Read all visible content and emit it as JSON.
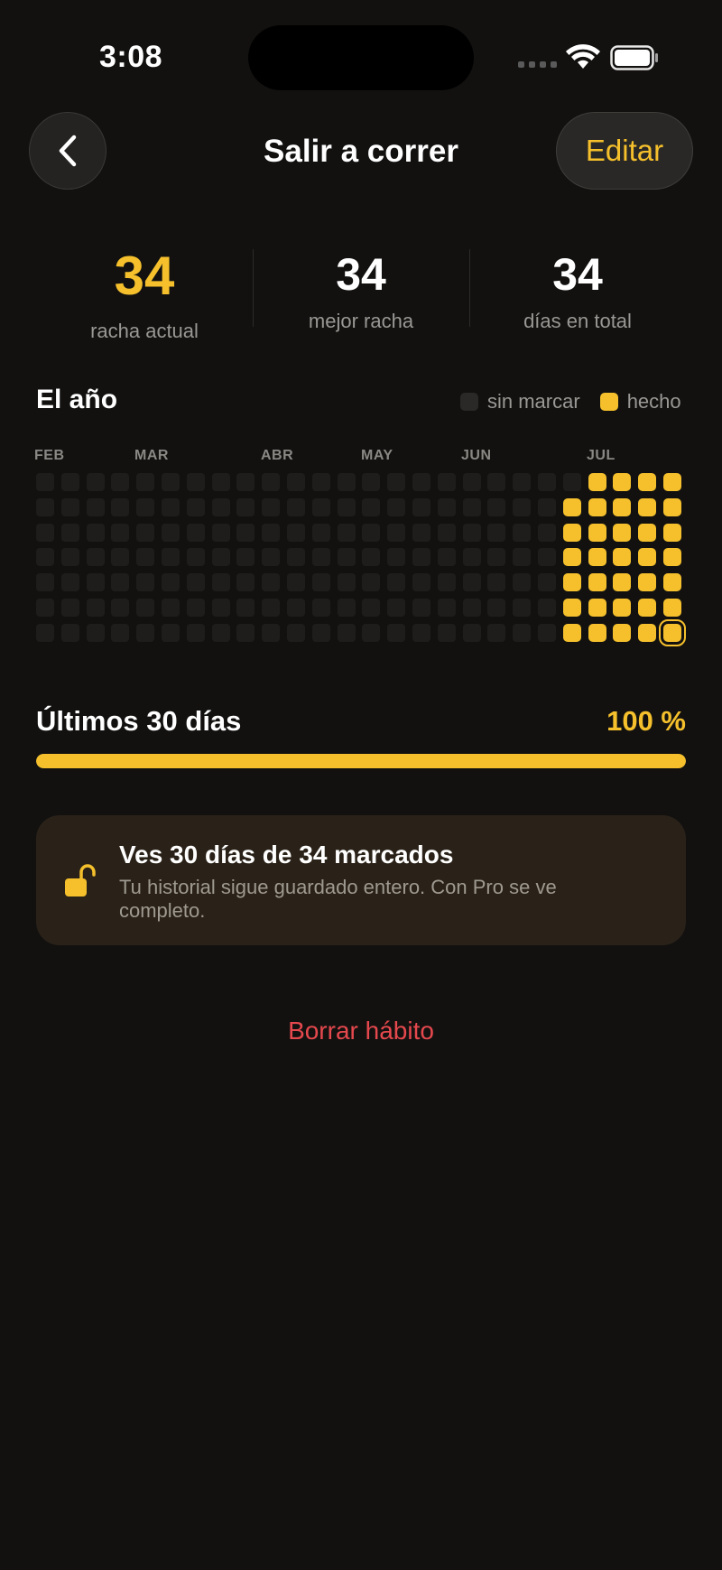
{
  "status_bar": {
    "time": "3:08"
  },
  "nav": {
    "title": "Salir a correr",
    "edit_label": "Editar",
    "back_icon": "chevron-left-icon"
  },
  "stats": [
    {
      "value": "34",
      "label": "racha actual",
      "accent": true
    },
    {
      "value": "34",
      "label": "mejor racha",
      "accent": false
    },
    {
      "value": "34",
      "label": "días en total",
      "accent": false
    }
  ],
  "year": {
    "title": "El año",
    "legend": {
      "unmarked": "sin marcar",
      "done": "hecho"
    },
    "months": [
      "FEB",
      "MAR",
      "ABR",
      "MAY",
      "JUN",
      "JUL"
    ],
    "weeks": 26,
    "days_per_week": 7,
    "done_days": 34,
    "colors": {
      "done": "#f5c02c",
      "empty": "#1e1d1c"
    }
  },
  "progress": {
    "title": "Últimos 30 días",
    "percent_label": "100 %",
    "fraction": 1.0
  },
  "notice": {
    "title": "Ves 30 días de 34 marcados",
    "text": "Tu historial sigue guardado entero. Con Pro se ve completo.",
    "icon": "unlock-icon"
  },
  "delete_label": "Borrar hábito",
  "colors": {
    "accent": "#f5c02c",
    "danger": "#e5484d",
    "background": "#121110"
  }
}
